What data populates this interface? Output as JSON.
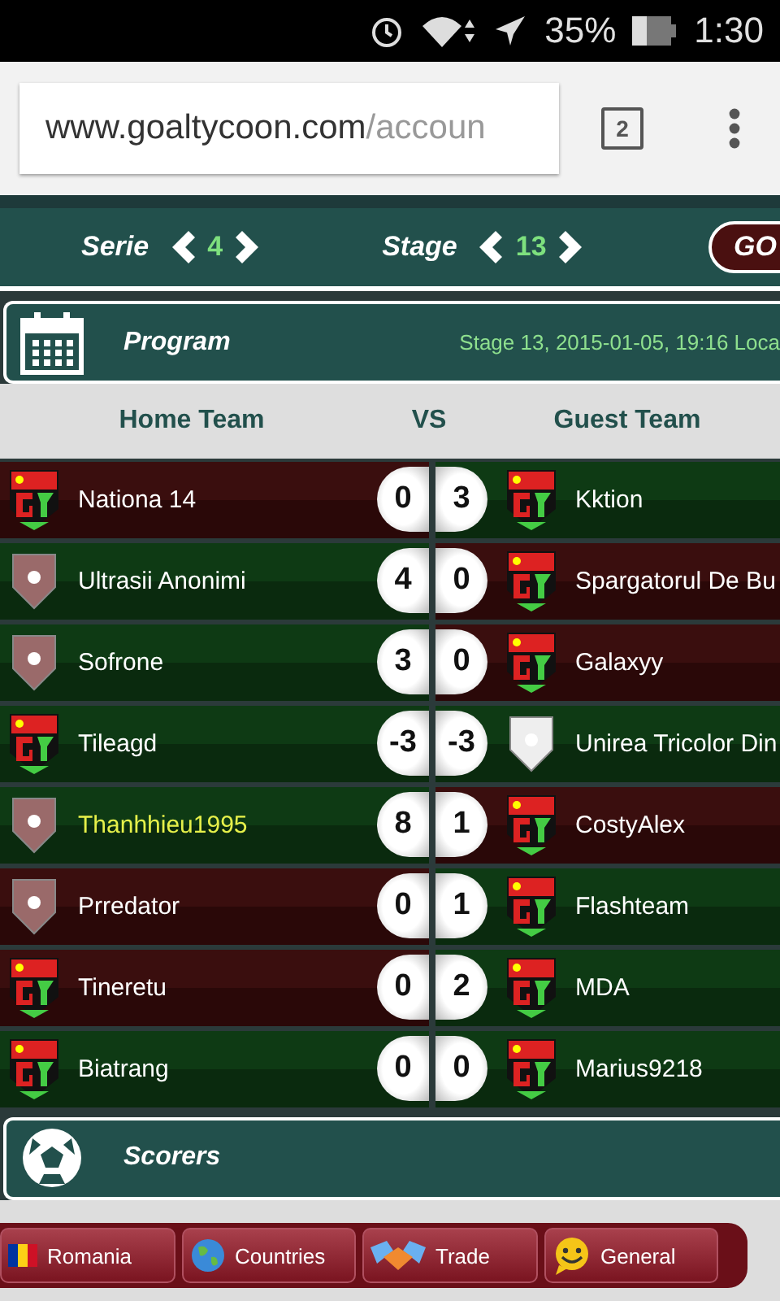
{
  "status_bar": {
    "battery": "35%",
    "time": "1:30"
  },
  "browser": {
    "url_host": "www.goaltycoon.com",
    "url_path": "/accoun",
    "tab_count": "2"
  },
  "nav": {
    "serie_label": "Serie",
    "serie_value": "4",
    "stage_label": "Stage",
    "stage_value": "13",
    "go_button": "GO"
  },
  "program": {
    "title": "Program",
    "info": "Stage 13, 2015-01-05, 19:16 Loca"
  },
  "columns": [
    "Home Team",
    "VS",
    "Guest Team"
  ],
  "matches": [
    {
      "home": {
        "name": "Nationa 14",
        "kind": "gt",
        "lost": true,
        "highlighted": false
      },
      "home_score": "0",
      "away_score": "3",
      "away": {
        "name": "Kktion",
        "kind": "gt",
        "lost": false,
        "highlighted": false
      }
    },
    {
      "home": {
        "name": "Ultrasii Anonimi",
        "kind": "plain",
        "lost": false,
        "highlighted": false
      },
      "home_score": "4",
      "away_score": "0",
      "away": {
        "name": "Spargatorul De Bu",
        "kind": "gt",
        "lost": true,
        "highlighted": false
      }
    },
    {
      "home": {
        "name": "Sofrone",
        "kind": "plain",
        "lost": false,
        "highlighted": false
      },
      "home_score": "3",
      "away_score": "0",
      "away": {
        "name": "Galaxyy",
        "kind": "gt",
        "lost": true,
        "highlighted": false
      }
    },
    {
      "home": {
        "name": "Tileagd",
        "kind": "gt",
        "lost": false,
        "highlighted": false
      },
      "home_score": "-3",
      "away_score": "-3",
      "away": {
        "name": "Unirea Tricolor Din",
        "kind": "plain",
        "lost": false,
        "highlighted": false
      }
    },
    {
      "home": {
        "name": "Thanhhieu1995",
        "kind": "plain",
        "lost": false,
        "highlighted": true
      },
      "home_score": "8",
      "away_score": "1",
      "away": {
        "name": "CostyAlex",
        "kind": "gt",
        "lost": true,
        "highlighted": false
      }
    },
    {
      "home": {
        "name": "Prredator",
        "kind": "plain",
        "lost": true,
        "highlighted": false
      },
      "home_score": "0",
      "away_score": "1",
      "away": {
        "name": "Flashteam",
        "kind": "gt",
        "lost": false,
        "highlighted": false
      }
    },
    {
      "home": {
        "name": "Tineretu",
        "kind": "gt",
        "lost": true,
        "highlighted": false
      },
      "home_score": "0",
      "away_score": "2",
      "away": {
        "name": "MDA",
        "kind": "gt",
        "lost": false,
        "highlighted": false
      }
    },
    {
      "home": {
        "name": "Biatrang",
        "kind": "gt",
        "lost": false,
        "highlighted": false
      },
      "home_score": "0",
      "away_score": "0",
      "away": {
        "name": "Marius9218",
        "kind": "gt",
        "lost": false,
        "highlighted": false
      }
    }
  ],
  "scorers": {
    "title": "Scorers"
  },
  "menu": [
    {
      "label": "Romania",
      "kind": "flag"
    },
    {
      "label": "Countries",
      "kind": "globe"
    },
    {
      "label": "Trade",
      "kind": "handshake"
    },
    {
      "label": "General",
      "kind": "smiley"
    }
  ]
}
